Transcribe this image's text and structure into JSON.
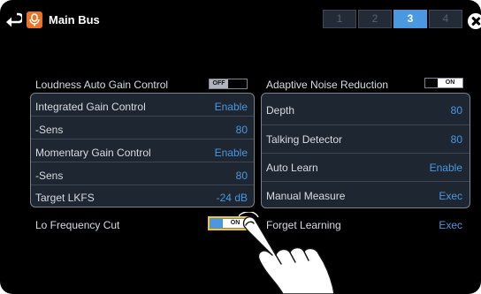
{
  "header": {
    "title": "Main Bus",
    "bank_tabs": [
      "1",
      "2",
      "3",
      "4"
    ],
    "active_bank": "3"
  },
  "left": {
    "loudness": {
      "label": "Loudness Auto Gain Control",
      "toggle": "OFF"
    },
    "group": [
      {
        "label": "Integrated Gain Control",
        "value": "Enable"
      },
      {
        "label": "-Sens",
        "value": "80"
      },
      {
        "label": "Momentary Gain Control",
        "value": "Enable"
      },
      {
        "label": "-Sens",
        "value": "80"
      },
      {
        "label": "Target LKFS",
        "value": "-24 dB"
      }
    ],
    "locut": {
      "label": "Lo Frequency Cut",
      "toggle": "ON"
    }
  },
  "right": {
    "anr": {
      "label": "Adaptive Noise Reduction",
      "toggle": "ON"
    },
    "group": [
      {
        "label": "Depth",
        "value": "80"
      },
      {
        "label": "Talking Detector",
        "value": "80"
      },
      {
        "label": "Auto Learn",
        "value": "Enable"
      },
      {
        "label": "Manual Measure",
        "value": "Exec"
      }
    ],
    "forget": {
      "label": "Forget Learning",
      "value": "Exec"
    }
  },
  "colors": {
    "accent": "#4a98e0",
    "bus_icon": "#e8742a",
    "highlight": "#e8c832"
  },
  "icons": {
    "back": "return-arrow-icon",
    "bus": "microphone-icon",
    "close": "close-icon",
    "hand": "pointing-hand-icon"
  }
}
